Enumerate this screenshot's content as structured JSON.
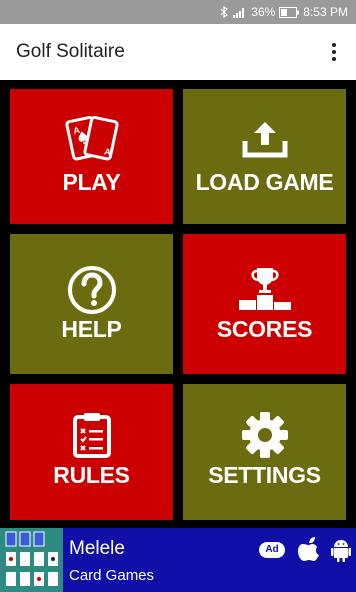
{
  "status_bar": {
    "battery": "36%",
    "time": "8:53 PM"
  },
  "app_bar": {
    "title": "Golf Solitaire"
  },
  "tiles": [
    {
      "label": "PLAY",
      "icon": "playing-cards-icon",
      "color": "#cc0000"
    },
    {
      "label": "LOAD GAME",
      "icon": "upload-icon",
      "color": "#6b6b0f"
    },
    {
      "label": "HELP",
      "icon": "question-circle-icon",
      "color": "#6b6b0f"
    },
    {
      "label": "SCORES",
      "icon": "trophy-podium-icon",
      "color": "#cc0000"
    },
    {
      "label": "RULES",
      "icon": "clipboard-checklist-icon",
      "color": "#cc0000"
    },
    {
      "label": "SETTINGS",
      "icon": "gear-icon",
      "color": "#6b6b0f"
    }
  ],
  "ad": {
    "title": "Melele",
    "subtitle": "Card Games",
    "badge": "Ad",
    "background": "#1010a8"
  }
}
